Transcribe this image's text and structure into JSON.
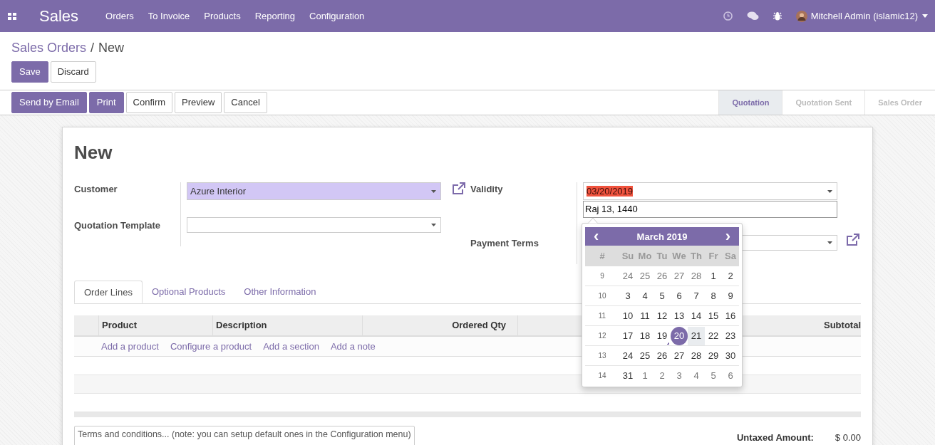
{
  "navbar": {
    "app": "Sales",
    "menu": [
      "Orders",
      "To Invoice",
      "Products",
      "Reporting",
      "Configuration"
    ],
    "user": "Mitchell Admin (islamic12)"
  },
  "breadcrumb": {
    "parent": "Sales Orders",
    "separator": "/",
    "current": "New"
  },
  "form_buttons": [
    {
      "label": "Save",
      "primary": true
    },
    {
      "label": "Discard",
      "primary": false
    }
  ],
  "action_buttons": [
    {
      "label": "Send by Email",
      "primary": true
    },
    {
      "label": "Print",
      "primary": true
    },
    {
      "label": "Confirm",
      "primary": false
    },
    {
      "label": "Preview",
      "primary": false
    },
    {
      "label": "Cancel",
      "primary": false
    }
  ],
  "stages": [
    {
      "label": "Quotation",
      "selected": true
    },
    {
      "label": "Quotation Sent",
      "selected": false
    },
    {
      "label": "Sales Order",
      "selected": false
    }
  ],
  "sheet": {
    "title": "New",
    "left_fields": [
      {
        "label": "Customer",
        "value": "Azure Interior",
        "highlighted": true
      },
      {
        "label": "Quotation Template",
        "highlighted": false
      }
    ],
    "validity": {
      "label": "Validity",
      "value": "03/20/2019",
      "alt_value": "Raj 13, 1440"
    },
    "payment_terms": {
      "label": "Payment Terms"
    },
    "tabs": [
      {
        "label": "Order Lines",
        "selected": true
      },
      {
        "label": "Optional Products",
        "selected": false
      },
      {
        "label": "Other Information",
        "selected": false
      }
    ],
    "columns": [
      "Product",
      "Description",
      "Ordered Qty",
      "Subtotal"
    ],
    "add_links": [
      "Add a product",
      "Configure a product",
      "Add a section",
      "Add a note"
    ],
    "terms_placeholder": "Terms and conditions... (note: you can setup default ones in the Configuration menu)",
    "untaxed": {
      "label": "Untaxed Amount:",
      "value": "$ 0.00"
    }
  },
  "datepicker": {
    "title": "March 2019",
    "prev": "‹",
    "next": "›",
    "weekday_header": [
      "#",
      "Su",
      "Mo",
      "Tu",
      "We",
      "Th",
      "Fr",
      "Sa"
    ],
    "weeks": [
      {
        "week": "9",
        "days": [
          {
            "day": "24",
            "other_month": true,
            "selected": false,
            "today": false,
            "hovered": false
          },
          {
            "day": "25",
            "other_month": true,
            "selected": false,
            "today": false,
            "hovered": false
          },
          {
            "day": "26",
            "other_month": true,
            "selected": false,
            "today": false,
            "hovered": false
          },
          {
            "day": "27",
            "other_month": true,
            "selected": false,
            "today": false,
            "hovered": false
          },
          {
            "day": "28",
            "other_month": true,
            "selected": false,
            "today": false,
            "hovered": false
          },
          {
            "day": "1",
            "other_month": false,
            "selected": false,
            "today": false,
            "hovered": false
          },
          {
            "day": "2",
            "other_month": false,
            "selected": false,
            "today": false,
            "hovered": false
          }
        ]
      },
      {
        "week": "10",
        "days": [
          {
            "day": "3",
            "other_month": false,
            "selected": false,
            "today": false,
            "hovered": false
          },
          {
            "day": "4",
            "other_month": false,
            "selected": false,
            "today": false,
            "hovered": false
          },
          {
            "day": "5",
            "other_month": false,
            "selected": false,
            "today": false,
            "hovered": false
          },
          {
            "day": "6",
            "other_month": false,
            "selected": false,
            "today": false,
            "hovered": false
          },
          {
            "day": "7",
            "other_month": false,
            "selected": false,
            "today": false,
            "hovered": false
          },
          {
            "day": "8",
            "other_month": false,
            "selected": false,
            "today": false,
            "hovered": false
          },
          {
            "day": "9",
            "other_month": false,
            "selected": false,
            "today": false,
            "hovered": false
          }
        ]
      },
      {
        "week": "11",
        "days": [
          {
            "day": "10",
            "other_month": false,
            "selected": false,
            "today": false,
            "hovered": false
          },
          {
            "day": "11",
            "other_month": false,
            "selected": false,
            "today": false,
            "hovered": false
          },
          {
            "day": "12",
            "other_month": false,
            "selected": false,
            "today": false,
            "hovered": false
          },
          {
            "day": "13",
            "other_month": false,
            "selected": false,
            "today": false,
            "hovered": false
          },
          {
            "day": "14",
            "other_month": false,
            "selected": false,
            "today": false,
            "hovered": false
          },
          {
            "day": "15",
            "other_month": false,
            "selected": false,
            "today": false,
            "hovered": false
          },
          {
            "day": "16",
            "other_month": false,
            "selected": false,
            "today": false,
            "hovered": false
          }
        ]
      },
      {
        "week": "12",
        "days": [
          {
            "day": "17",
            "other_month": false,
            "selected": false,
            "today": false,
            "hovered": false
          },
          {
            "day": "18",
            "other_month": false,
            "selected": false,
            "today": false,
            "hovered": false
          },
          {
            "day": "19",
            "other_month": false,
            "selected": false,
            "today": true,
            "hovered": false
          },
          {
            "day": "20",
            "other_month": false,
            "selected": true,
            "today": false,
            "hovered": false
          },
          {
            "day": "21",
            "other_month": false,
            "selected": false,
            "today": false,
            "hovered": true
          },
          {
            "day": "22",
            "other_month": false,
            "selected": false,
            "today": false,
            "hovered": false
          },
          {
            "day": "23",
            "other_month": false,
            "selected": false,
            "today": false,
            "hovered": false
          }
        ]
      },
      {
        "week": "13",
        "days": [
          {
            "day": "24",
            "other_month": false,
            "selected": false,
            "today": false,
            "hovered": false
          },
          {
            "day": "25",
            "other_month": false,
            "selected": false,
            "today": false,
            "hovered": false
          },
          {
            "day": "26",
            "other_month": false,
            "selected": false,
            "today": false,
            "hovered": false
          },
          {
            "day": "27",
            "other_month": false,
            "selected": false,
            "today": false,
            "hovered": false
          },
          {
            "day": "28",
            "other_month": false,
            "selected": false,
            "today": false,
            "hovered": false
          },
          {
            "day": "29",
            "other_month": false,
            "selected": false,
            "today": false,
            "hovered": false
          },
          {
            "day": "30",
            "other_month": false,
            "selected": false,
            "today": false,
            "hovered": false
          }
        ]
      },
      {
        "week": "14",
        "days": [
          {
            "day": "31",
            "other_month": false,
            "selected": false,
            "today": false,
            "hovered": false
          },
          {
            "day": "1",
            "other_month": true,
            "selected": false,
            "today": false,
            "hovered": false
          },
          {
            "day": "2",
            "other_month": true,
            "selected": false,
            "today": false,
            "hovered": false
          },
          {
            "day": "3",
            "other_month": true,
            "selected": false,
            "today": false,
            "hovered": false
          },
          {
            "day": "4",
            "other_month": true,
            "selected": false,
            "today": false,
            "hovered": false
          },
          {
            "day": "5",
            "other_month": true,
            "selected": false,
            "today": false,
            "hovered": false
          },
          {
            "day": "6",
            "other_month": true,
            "selected": false,
            "today": false,
            "hovered": false
          }
        ]
      }
    ]
  }
}
